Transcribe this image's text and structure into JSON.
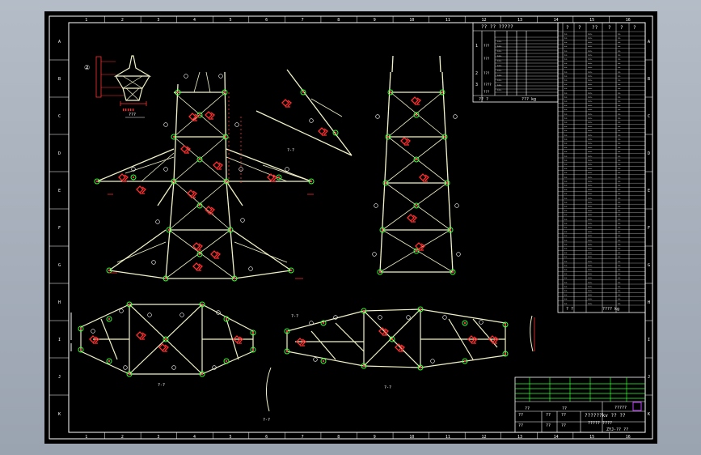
{
  "app": {
    "theme_colors": {
      "background": "#000000",
      "frame": "#ffffff",
      "member": "#f2f2c8",
      "joint": "#32ff32",
      "mark": "#ff3030",
      "text": "#ffffff",
      "viewport": "#a9b1bd"
    }
  },
  "sheet": {
    "column_labels": [
      "1",
      "2",
      "3",
      "4",
      "5",
      "6",
      "7",
      "8",
      "9",
      "10",
      "11",
      "12",
      "13",
      "14",
      "15",
      "16"
    ],
    "row_labels": [
      "A",
      "B",
      "C",
      "D",
      "E",
      "F",
      "G",
      "H",
      "I",
      "J",
      "K"
    ],
    "icons": [
      "pan-icon",
      "zoom-icon"
    ]
  },
  "views": {
    "section_label": "???",
    "detail_marker": "②",
    "view_labels": [
      "?-?",
      "?-?",
      "?-?",
      "?-?",
      "?-?"
    ]
  },
  "table_top": {
    "header": "?? ?? ?????",
    "rows": [
      {
        "mark": "1",
        "label": "???"
      },
      {
        "mark": "",
        "label": "???"
      },
      {
        "mark": "2",
        "label": "???"
      },
      {
        "mark": "3",
        "label": "????"
      },
      {
        "mark": "?",
        "label": "???"
      }
    ],
    "total_label": "?? ?",
    "total_value": "??? kg"
  },
  "table_right": {
    "header": [
      "?",
      "?",
      "??",
      "?",
      "?",
      "?"
    ],
    "footer_label": "? ?",
    "footer_value": "???? kg"
  },
  "title_block": {
    "company": "?????",
    "title": "??????kv ?? ??",
    "subtitle": "????? ????",
    "drawing_no": "ZYJ-?? ??",
    "scale": "??",
    "sheet": "??",
    "cells": [
      "??",
      "??",
      "??",
      "??",
      "??",
      "??"
    ]
  }
}
